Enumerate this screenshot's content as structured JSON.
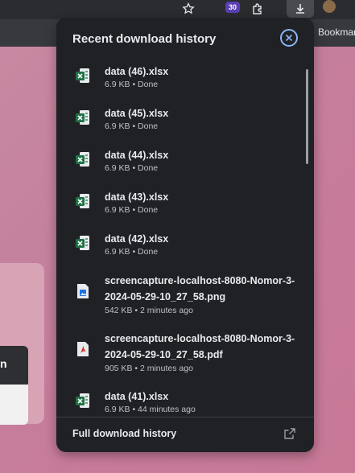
{
  "toolbar": {
    "extension_badge": "30",
    "bookmarks_label": "Bookmar"
  },
  "panel": {
    "title": "Recent download history",
    "footer_label": "Full download history",
    "items": [
      {
        "name": "data (46).xlsx",
        "status": "6.9 KB • Done",
        "type": "xlsx"
      },
      {
        "name": "data (45).xlsx",
        "status": "6.9 KB • Done",
        "type": "xlsx"
      },
      {
        "name": "data (44).xlsx",
        "status": "6.9 KB • Done",
        "type": "xlsx"
      },
      {
        "name": "data (43).xlsx",
        "status": "6.9 KB • Done",
        "type": "xlsx"
      },
      {
        "name": "data (42).xlsx",
        "status": "6.9 KB • Done",
        "type": "xlsx"
      },
      {
        "name": "screencapture-localhost-8080-Nomor-3-2024-05-29-10_27_58.png",
        "status": "542 KB • 2 minutes ago",
        "type": "png"
      },
      {
        "name": "screencapture-localhost-8080-Nomor-3-2024-05-29-10_27_58.pdf",
        "status": "905 KB • 2 minutes ago",
        "type": "pdf"
      },
      {
        "name": "data (41).xlsx",
        "status": "6.9 KB • 44 minutes ago",
        "type": "xlsx"
      }
    ]
  },
  "page": {
    "card_fragment_text": "n"
  },
  "colors": {
    "accent": "#8ab4f8",
    "panel_bg": "#202124",
    "excel_green": "#1e7145",
    "pdf_red": "#d93025",
    "png_blue": "#1a73e8"
  }
}
